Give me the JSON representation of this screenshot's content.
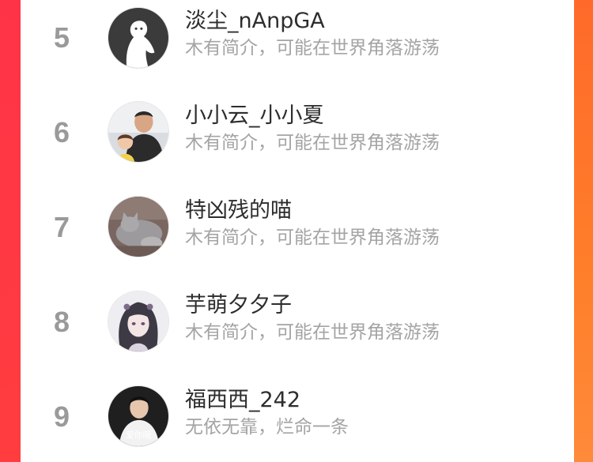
{
  "colors": {
    "rank": "#9a9a9a",
    "name": "#2d2d2d",
    "bio": "#a4a4a4",
    "background_left": "#ff3b4a",
    "background_right": "#ff7a2f"
  },
  "list": {
    "items": [
      {
        "rank": "5",
        "name": "淡尘_nAnpGA",
        "bio": "木有简介，可能在世界角落游荡",
        "avatar": "default-ghost-avatar"
      },
      {
        "rank": "6",
        "name": "小小云_小小夏",
        "bio": "木有简介，可能在世界角落游荡",
        "avatar": "man-with-child-photo"
      },
      {
        "rank": "7",
        "name": "特凶残的喵",
        "bio": "木有简介，可能在世界角落游荡",
        "avatar": "gray-cat-photo"
      },
      {
        "rank": "8",
        "name": "芋萌夕夕子",
        "bio": "木有简介，可能在世界角落游荡",
        "avatar": "anime-girl-drawing"
      },
      {
        "rank": "9",
        "name": "福西西_242",
        "bio": "无依无靠，烂命一条",
        "avatar": "young-man-photo",
        "avatar_caption": "爱你哦"
      }
    ]
  }
}
